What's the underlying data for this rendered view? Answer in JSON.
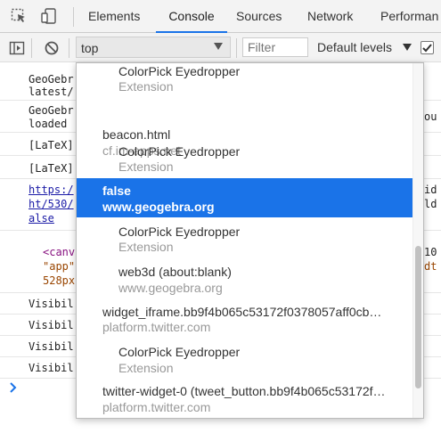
{
  "tabs": [
    {
      "label": "Elements"
    },
    {
      "label": "Console"
    },
    {
      "label": "Sources"
    },
    {
      "label": "Network"
    },
    {
      "label": "Performan"
    }
  ],
  "toolbar": {
    "context_value": "top",
    "filter_placeholder": "Filter",
    "levels_label": "Default levels"
  },
  "log_lines": [
    {
      "text": "GeoGebr"
    },
    {
      "text": "latest/"
    },
    {
      "text": "GeoGebr"
    },
    {
      "text": "loaded"
    },
    {
      "text": "[LaTeX]"
    },
    {
      "text": "[LaTeX]"
    },
    {
      "text": "https:/"
    },
    {
      "text": "ht/530/"
    },
    {
      "text": "alse"
    },
    {
      "text": "<canv"
    },
    {
      "text": "\"app\""
    },
    {
      "text": "528px"
    },
    {
      "text": "Visibil"
    },
    {
      "text": "Visibil"
    },
    {
      "text": "Visibil"
    },
    {
      "text": "Visibil"
    }
  ],
  "log_right": [
    {
      "text": "ou"
    },
    {
      "text": "id"
    },
    {
      "text": "ld"
    },
    {
      "text": "10"
    },
    {
      "text": "dt"
    }
  ],
  "dropdown": {
    "items": [
      {
        "title": "ColorPick Eyedropper",
        "subtitle": "Extension"
      },
      {
        "title": "beacon.html",
        "subtitle": "cf.im-apps.net"
      },
      {
        "title": "ColorPick Eyedropper",
        "subtitle": "Extension"
      },
      {
        "title": "false",
        "subtitle": "www.geogebra.org"
      },
      {
        "title": "ColorPick Eyedropper",
        "subtitle": "Extension"
      },
      {
        "title": "web3d (about:blank)",
        "subtitle": "www.geogebra.org"
      },
      {
        "title": "widget_iframe.bb9f4b065c53172f0378057aff0cb…",
        "subtitle": "platform.twitter.com"
      },
      {
        "title": "ColorPick Eyedropper",
        "subtitle": "Extension"
      },
      {
        "title": "twitter-widget-0 (tweet_button.bb9f4b065c53172f…",
        "subtitle": "platform.twitter.com"
      }
    ]
  },
  "colors": {
    "accent": "#1a73e8",
    "selected_bg": "#1a73e8"
  }
}
